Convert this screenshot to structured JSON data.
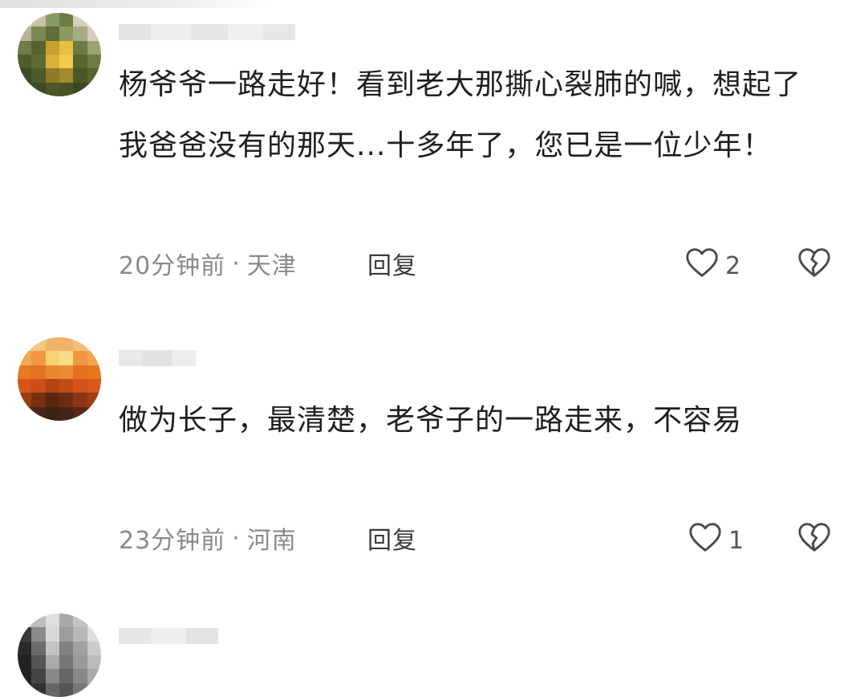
{
  "comments": [
    {
      "text": "杨爷爷一路走好！看到老大那撕心裂肺的喊，想起了我爸爸没有的那天...十多年了，您已是一位少年！",
      "time": "20分钟前",
      "separator": "·",
      "location": "天津",
      "reply_label": "回复",
      "likes": "2",
      "avatar_colors": [
        "#d8d2c2",
        "#8d9a6a",
        "#5d6b3a",
        "#c7a236",
        "#e8c34a",
        "#3e4a2a"
      ]
    },
    {
      "text": "做为长子，最清楚，老爷子的一路走来，不容易",
      "time": "23分钟前",
      "separator": "·",
      "location": "河南",
      "reply_label": "回复",
      "likes": "1",
      "avatar_colors": [
        "#f3c27a",
        "#e98a2a",
        "#d4541a",
        "#8a2a10",
        "#5a3a2a",
        "#c96a28"
      ]
    }
  ],
  "icons": {
    "like": "heart-outline-icon",
    "dislike": "broken-heart-icon"
  },
  "colors": {
    "text": "#1f1f1f",
    "meta": "#8a8a8a",
    "reply": "#3a3a3a"
  }
}
